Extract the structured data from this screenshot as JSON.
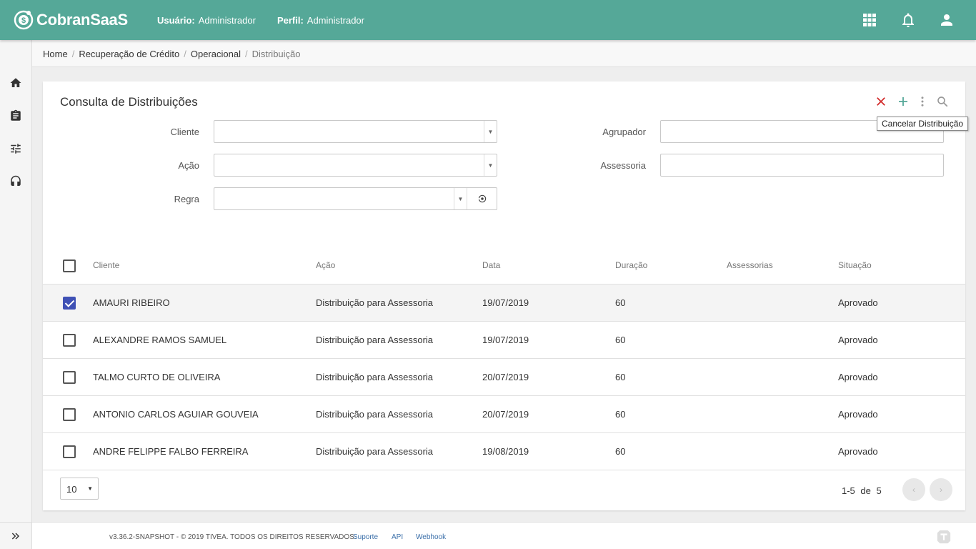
{
  "header": {
    "logo_text": "CobranSaaS",
    "user_label": "Usuário:",
    "user_value": "Administrador",
    "profile_label": "Perfil:",
    "profile_value": "Administrador",
    "icons": [
      "apps-grid-icon",
      "bell-icon",
      "account-icon"
    ],
    "bg_color": "#55a898"
  },
  "sidebar": {
    "items": [
      {
        "icon": "home-icon"
      },
      {
        "icon": "clipboard-icon"
      },
      {
        "icon": "tune-icon"
      },
      {
        "icon": "headset-icon"
      }
    ],
    "expand_icon": "double-chevron-right-icon"
  },
  "breadcrumb": [
    "Home",
    "Recuperação de Crédito",
    "Operacional",
    "Distribuição"
  ],
  "page": {
    "title": "Consulta de Distribuições",
    "toolbar": {
      "icons": [
        "close-icon",
        "add-icon",
        "more-vert-icon",
        "search-icon"
      ],
      "tooltip": "Cancelar Distribuição"
    }
  },
  "filters": {
    "cliente": {
      "label": "Cliente",
      "value": ""
    },
    "acao": {
      "label": "Ação",
      "value": ""
    },
    "regra": {
      "label": "Regra",
      "value": ""
    },
    "agrupador": {
      "label": "Agrupador",
      "value": ""
    },
    "assessoria": {
      "label": "Assessoria",
      "value": ""
    }
  },
  "table": {
    "columns": [
      "Cliente",
      "Ação",
      "Data",
      "Duração",
      "Assessorias",
      "Situação"
    ],
    "rows": [
      {
        "checked": true,
        "cliente": "AMAURI RIBEIRO",
        "acao": "Distribuição para Assessoria",
        "data": "19/07/2019",
        "duracao": "60",
        "assessorias": "",
        "situacao": "Aprovado"
      },
      {
        "checked": false,
        "cliente": "ALEXANDRE RAMOS SAMUEL",
        "acao": "Distribuição para Assessoria",
        "data": "19/07/2019",
        "duracao": "60",
        "assessorias": "",
        "situacao": "Aprovado"
      },
      {
        "checked": false,
        "cliente": "TALMO CURTO DE OLIVEIRA",
        "acao": "Distribuição para Assessoria",
        "data": "20/07/2019",
        "duracao": "60",
        "assessorias": "",
        "situacao": "Aprovado"
      },
      {
        "checked": false,
        "cliente": "ANTONIO CARLOS AGUIAR GOUVEIA",
        "acao": "Distribuição para Assessoria",
        "data": "20/07/2019",
        "duracao": "60",
        "assessorias": "",
        "situacao": "Aprovado"
      },
      {
        "checked": false,
        "cliente": "ANDRE FELIPPE FALBO FERREIRA",
        "acao": "Distribuição para Assessoria",
        "data": "19/08/2019",
        "duracao": "60",
        "assessorias": "",
        "situacao": "Aprovado"
      }
    ]
  },
  "pagination": {
    "page_size": "10",
    "range": "1-5",
    "of_label": "de",
    "total": "5",
    "prev": "‹",
    "next": "›"
  },
  "footer": {
    "version": "v3.36.2-SNAPSHOT - © 2019 TIVEA. TODOS OS DIREITOS RESERVADOS.",
    "links": [
      "Suporte",
      "API",
      "Webhook"
    ]
  },
  "colors": {
    "accent": "#55a898",
    "checkbox_checked": "#3f51b5",
    "cancel": "#d32f2f",
    "add": "#55a898"
  }
}
